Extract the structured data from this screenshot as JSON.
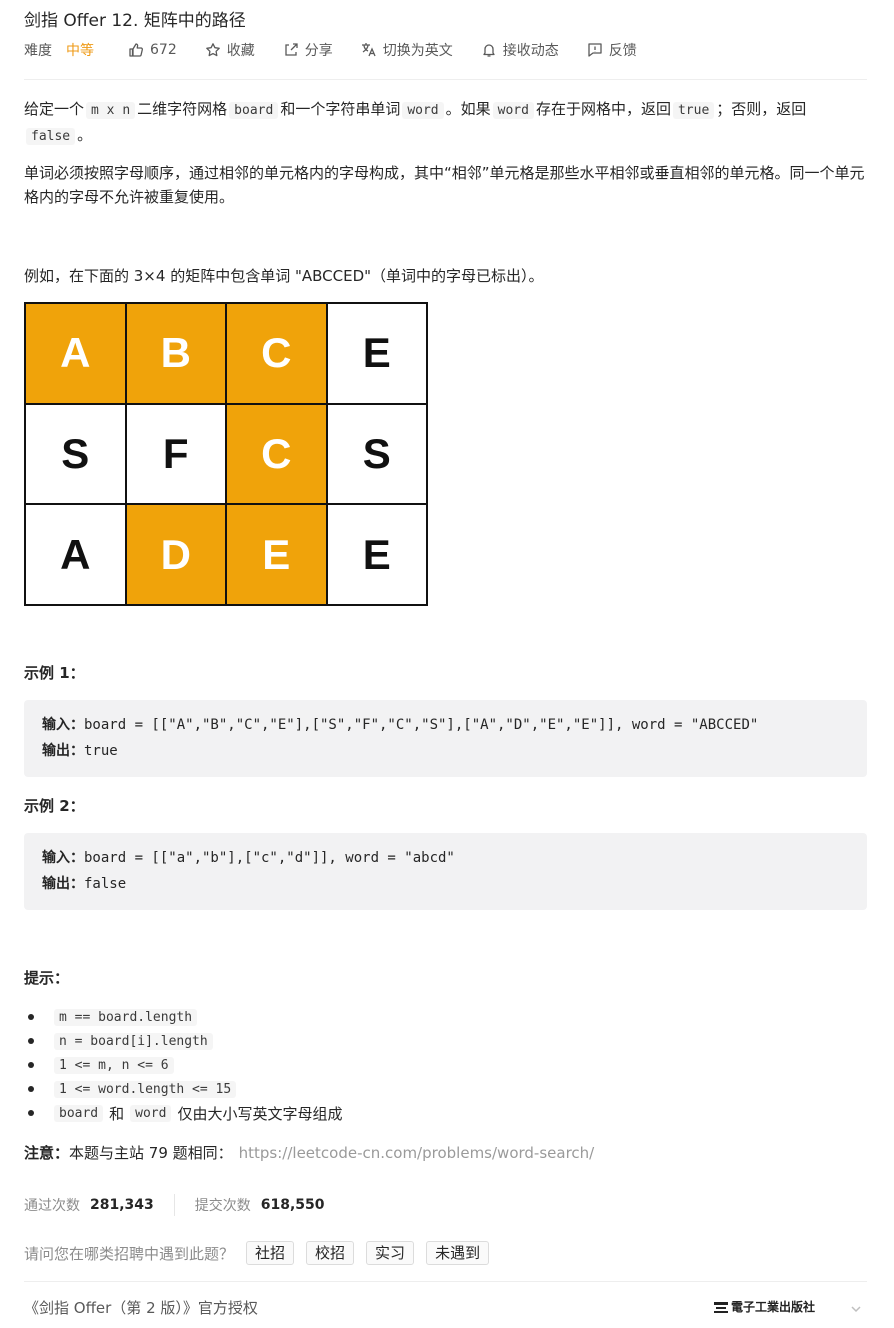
{
  "header": {
    "title": "剑指 Offer 12. 矩阵中的路径",
    "difficulty_label": "难度",
    "difficulty_value": "中等",
    "likes": "672",
    "collect": "收藏",
    "share": "分享",
    "switch_lang": "切换为英文",
    "subscribe": "接收动态",
    "feedback": "反馈"
  },
  "description": {
    "p1_a": "给定一个",
    "p1_code1": "m x n",
    "p1_b": "二维字符网格",
    "p1_code2": "board",
    "p1_c": "和一个字符串单词",
    "p1_code3": "word",
    "p1_d": "。如果",
    "p1_code4": "word",
    "p1_e": "存在于网格中，返回",
    "p1_code5": "true",
    "p1_f": "；否则，返回",
    "p1_code6": "false",
    "p1_g": "。",
    "p2": "单词必须按照字母顺序，通过相邻的单元格内的字母构成，其中“相邻”单元格是那些水平相邻或垂直相邻的单元格。同一个单元格内的字母不允许被重复使用。",
    "p3": "例如，在下面的 3×4 的矩阵中包含单词 \"ABCCED\"（单词中的字母已标出）。"
  },
  "grid": {
    "colors": {
      "highlight": "#f0a30a",
      "plain": "#ffffff"
    },
    "rows": [
      [
        {
          "c": "A",
          "h": true
        },
        {
          "c": "B",
          "h": true
        },
        {
          "c": "C",
          "h": true
        },
        {
          "c": "E",
          "h": false
        }
      ],
      [
        {
          "c": "S",
          "h": false
        },
        {
          "c": "F",
          "h": false
        },
        {
          "c": "C",
          "h": true
        },
        {
          "c": "S",
          "h": false
        }
      ],
      [
        {
          "c": "A",
          "h": false
        },
        {
          "c": "D",
          "h": true
        },
        {
          "c": "E",
          "h": true
        },
        {
          "c": "E",
          "h": false
        }
      ]
    ]
  },
  "examples": [
    {
      "heading": "示例 1：",
      "input_label": "输入：",
      "input": "board = [[\"A\",\"B\",\"C\",\"E\"],[\"S\",\"F\",\"C\",\"S\"],[\"A\",\"D\",\"E\",\"E\"]], word = \"ABCCED\"",
      "output_label": "输出：",
      "output": "true"
    },
    {
      "heading": "示例 2：",
      "input_label": "输入：",
      "input": "board = [[\"a\",\"b\"],[\"c\",\"d\"]], word = \"abcd\"",
      "output_label": "输出：",
      "output": "false"
    }
  ],
  "hints": {
    "heading": "提示：",
    "items": [
      "m == board.length",
      "n = board[i].length",
      "1 <= m, n <= 6",
      "1 <= word.length <= 15"
    ],
    "last_code1": "board",
    "last_mid": "和",
    "last_code2": "word",
    "last_tail": "仅由大小写英文字母组成"
  },
  "note": {
    "label": "注意：",
    "text": "本题与主站 79 题相同：",
    "link": "https://leetcode-cn.com/problems/word-search/"
  },
  "stats": {
    "accepted_label": "通过次数",
    "accepted_value": "281,343",
    "submitted_label": "提交次数",
    "submitted_value": "618,550"
  },
  "survey": {
    "question": "请问您在哪类招聘中遇到此题？",
    "tags": [
      "社招",
      "校招",
      "实习",
      "未遇到"
    ]
  },
  "footer": {
    "text": "《剑指 Offer（第 2 版）》官方授权",
    "publisher_logo": "電子工業出版社"
  }
}
